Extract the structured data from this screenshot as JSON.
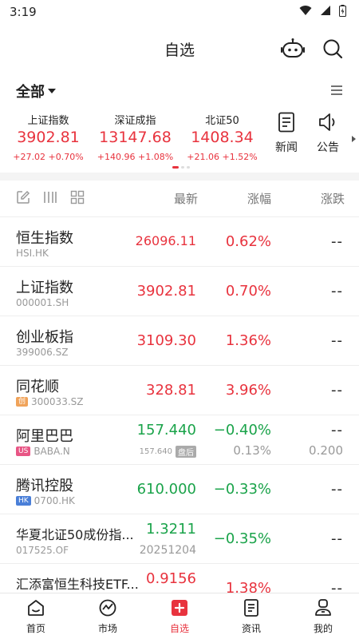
{
  "status": {
    "time": "3:19"
  },
  "header": {
    "title": "自选"
  },
  "filter": {
    "label": "全部"
  },
  "indices": [
    {
      "name": "上证指数",
      "value": "3902.81",
      "change": "+27.02",
      "pct": "+0.70%"
    },
    {
      "name": "深证成指",
      "value": "13147.68",
      "change": "+140.96",
      "pct": "+1.08%"
    },
    {
      "name": "北证50",
      "value": "1408.34",
      "change": "+21.06",
      "pct": "+1.52%"
    }
  ],
  "tools": [
    {
      "label": "新闻",
      "icon": "news-icon"
    },
    {
      "label": "公告",
      "icon": "announcement-icon"
    }
  ],
  "columns": {
    "latest": "最新",
    "pct": "涨幅",
    "chg": "涨跌"
  },
  "rows": [
    {
      "name": "恒生指数",
      "code": "HSI.HK",
      "tag": "",
      "price": "26096.11",
      "pct": "0.62%",
      "chg": "--"
    },
    {
      "name": "上证指数",
      "code": "000001.SH",
      "tag": "",
      "price": "3902.81",
      "pct": "0.70%",
      "chg": "--"
    },
    {
      "name": "创业板指",
      "code": "399006.SZ",
      "tag": "",
      "price": "3109.30",
      "pct": "1.36%",
      "chg": "--"
    },
    {
      "name": "同花顺",
      "code": "300033.SZ",
      "tag": "创",
      "price": "328.81",
      "pct": "3.96%",
      "chg": "--"
    },
    {
      "name": "阿里巴巴",
      "code": "BABA.N",
      "tag": "US",
      "price": "157.440",
      "pct": "−0.40%",
      "chg": "--",
      "post_price": "157.640",
      "post_label": "盘后",
      "post_pct": "0.13%",
      "post_chg": "0.200"
    },
    {
      "name": "腾讯控股",
      "code": "0700.HK",
      "tag": "HK",
      "price": "610.000",
      "pct": "−0.33%",
      "chg": "--"
    },
    {
      "name": "华夏北证50成份指...",
      "code": "017525.OF",
      "tag": "",
      "price": "1.3211",
      "pct": "−0.35%",
      "chg": "--",
      "date": "20251204"
    },
    {
      "name": "汇添富恒生科技ETF...",
      "code": "",
      "tag": "",
      "price": "0.9156",
      "pct": "1.38%",
      "chg": "--"
    }
  ],
  "tabs": [
    {
      "label": "首页",
      "icon": "home-icon"
    },
    {
      "label": "市场",
      "icon": "market-icon"
    },
    {
      "label": "自选",
      "icon": "watchlist-icon"
    },
    {
      "label": "资讯",
      "icon": "news-tab-icon"
    },
    {
      "label": "我的",
      "icon": "profile-icon"
    }
  ],
  "colors": {
    "up": "#e8333e",
    "down": "#1aa34a",
    "accent": "#e8333e"
  }
}
